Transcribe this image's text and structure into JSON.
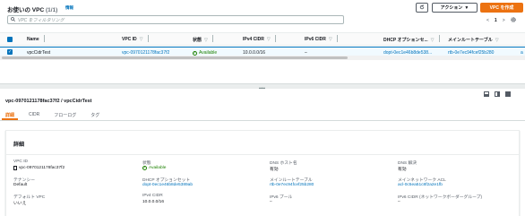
{
  "header": {
    "title": "お使いの VPC",
    "count": "(1/1)",
    "info_link": "情報",
    "refresh_icon": "refresh-icon",
    "actions_label": "アクション",
    "create_label": "VPC を作成"
  },
  "search": {
    "placeholder": "VPC をフィルタリング"
  },
  "pager": {
    "prev": "<",
    "page": "1",
    "next": ">",
    "settings_icon": "gear-icon"
  },
  "table": {
    "columns": [
      "Name",
      "VPC ID",
      "状態",
      "IPv4 CIDR",
      "IPv6 CIDR",
      "DHCP オプションセ...",
      "メインルートテーブル"
    ],
    "rows": [
      {
        "name": "vpcCidrTest",
        "vpc_id": "vpc-0970121178fac37f2",
        "state": "Available",
        "ipv4_cidr": "10.0.0.0/16",
        "ipv6_cidr": "–",
        "dhcp": "dopt-0ec1e46b8de538...",
        "main_route_table": "rtb-0e7ec94fcef25b280",
        "truncated": "a"
      }
    ]
  },
  "detail": {
    "title": "vpc-0970121178fac37f2 / vpcCidrTest",
    "tabs": [
      "詳細",
      "CIDR",
      "フローログ",
      "タグ"
    ],
    "heading": "詳細",
    "fields": {
      "vpc_id_label": "VPC ID",
      "vpc_id_value": "vpc-0970121178fac37f2",
      "state_label": "状態",
      "state_value": "Available",
      "dns_hostname_label": "DNS ホスト名",
      "dns_hostname_value": "有効",
      "dns_resolution_label": "DNS 解決",
      "dns_resolution_value": "有効",
      "tenancy_label": "テナンシー",
      "tenancy_value": "Default",
      "dhcp_label": "DHCP オプションセット",
      "dhcp_value": "dopt-0ec1e46b8de5389ab",
      "main_rt_label": "メインルートテーブル",
      "main_rt_value": "rtb-0e7ec94fcef25b280",
      "main_acl_label": "メインネットワーク ACL",
      "main_acl_value": "acl-0c5ea51c8f2a2e1fb",
      "default_vpc_label": "デフォルト VPC",
      "default_vpc_value": "いいえ",
      "ipv4_cidr_label": "IPv4 CIDR",
      "ipv4_cidr_value": "10.0.0.0/16",
      "ipv6_pool_label": "IPv6 プール",
      "ipv6_pool_value": "–",
      "ipv6_cidr_group_label": "IPv6 CIDR (ネットワークボーダーグループ)",
      "ipv6_cidr_group_value": "–"
    }
  },
  "colors": {
    "accent": "#ec7211",
    "link": "#0073bb",
    "available": "#1d8102"
  }
}
